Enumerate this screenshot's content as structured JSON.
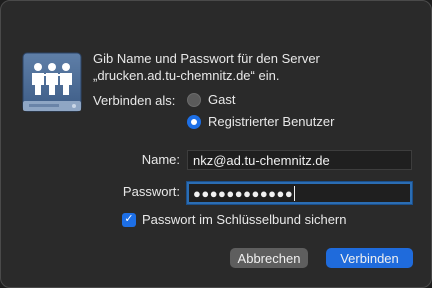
{
  "dialog": {
    "message": "Gib Name und Passwort für den Server\n„drucken.ad.tu-chemnitz.de“ ein.",
    "connect_as_label": "Verbinden als:",
    "options": {
      "guest": "Gast",
      "registered": "Registrierter Benutzer",
      "selected": "registered"
    },
    "name_label": "Name:",
    "name_value": "nkz@ad.tu-chemnitz.de",
    "password_label": "Passwort:",
    "password_mask": "●●●●●●●●●●●●",
    "keychain_label": "Passwort im Schlüsselbund sichern",
    "keychain_checked": true,
    "cancel_label": "Abbrechen",
    "connect_label": "Verbinden",
    "server_icon": "shared-server-icon",
    "accent_color": "#1f6bdc"
  }
}
